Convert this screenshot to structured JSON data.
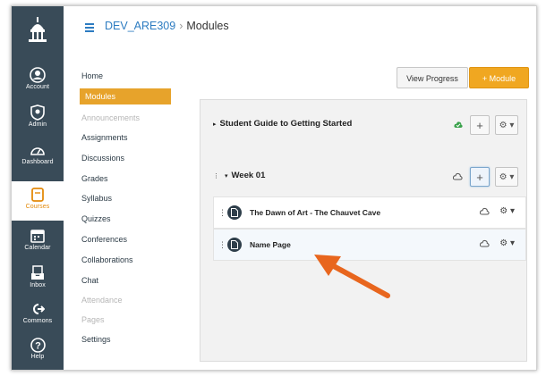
{
  "global_nav": {
    "items": [
      {
        "label": "Account",
        "icon": "account-icon"
      },
      {
        "label": "Admin",
        "icon": "shield-icon"
      },
      {
        "label": "Dashboard",
        "icon": "dashboard-icon"
      },
      {
        "label": "Courses",
        "icon": "book-icon"
      },
      {
        "label": "Calendar",
        "icon": "calendar-icon"
      },
      {
        "label": "Inbox",
        "icon": "inbox-icon"
      },
      {
        "label": "Commons",
        "icon": "commons-icon"
      },
      {
        "label": "Help",
        "icon": "help-icon"
      }
    ],
    "active": "Courses"
  },
  "header": {
    "course": "DEV_ARE309",
    "separator": "›",
    "page": "Modules"
  },
  "course_nav": {
    "items": [
      {
        "label": "Home",
        "state": "normal"
      },
      {
        "label": "Modules",
        "state": "active"
      },
      {
        "label": "Announcements",
        "state": "dim"
      },
      {
        "label": "Assignments",
        "state": "normal"
      },
      {
        "label": "Discussions",
        "state": "normal"
      },
      {
        "label": "Grades",
        "state": "normal"
      },
      {
        "label": "Syllabus",
        "state": "normal"
      },
      {
        "label": "Quizzes",
        "state": "normal"
      },
      {
        "label": "Conferences",
        "state": "normal"
      },
      {
        "label": "Collaborations",
        "state": "normal"
      },
      {
        "label": "Chat",
        "state": "normal"
      },
      {
        "label": "Attendance",
        "state": "dim"
      },
      {
        "label": "Pages",
        "state": "dim"
      },
      {
        "label": "Settings",
        "state": "normal"
      }
    ]
  },
  "toolbar": {
    "view_progress": "View Progress",
    "add_module": "+ Module"
  },
  "modules": [
    {
      "title": "Student Guide to Getting Started",
      "caret": "▸",
      "published": true,
      "add_label": "+",
      "gear_label": "⚙ ▾"
    },
    {
      "title": "Week 01",
      "caret": "▾",
      "published": false,
      "add_label": "+",
      "gear_label": "⚙ ▾",
      "items": [
        {
          "name": "The Dawn of Art - The Chauvet Cave"
        },
        {
          "name": "Name Page"
        }
      ]
    }
  ],
  "colors": {
    "nav_bg": "#394b58",
    "accent": "#f0a721",
    "link": "#2d7cc1",
    "arrow": "#e8661e",
    "published": "#3aa14b"
  }
}
